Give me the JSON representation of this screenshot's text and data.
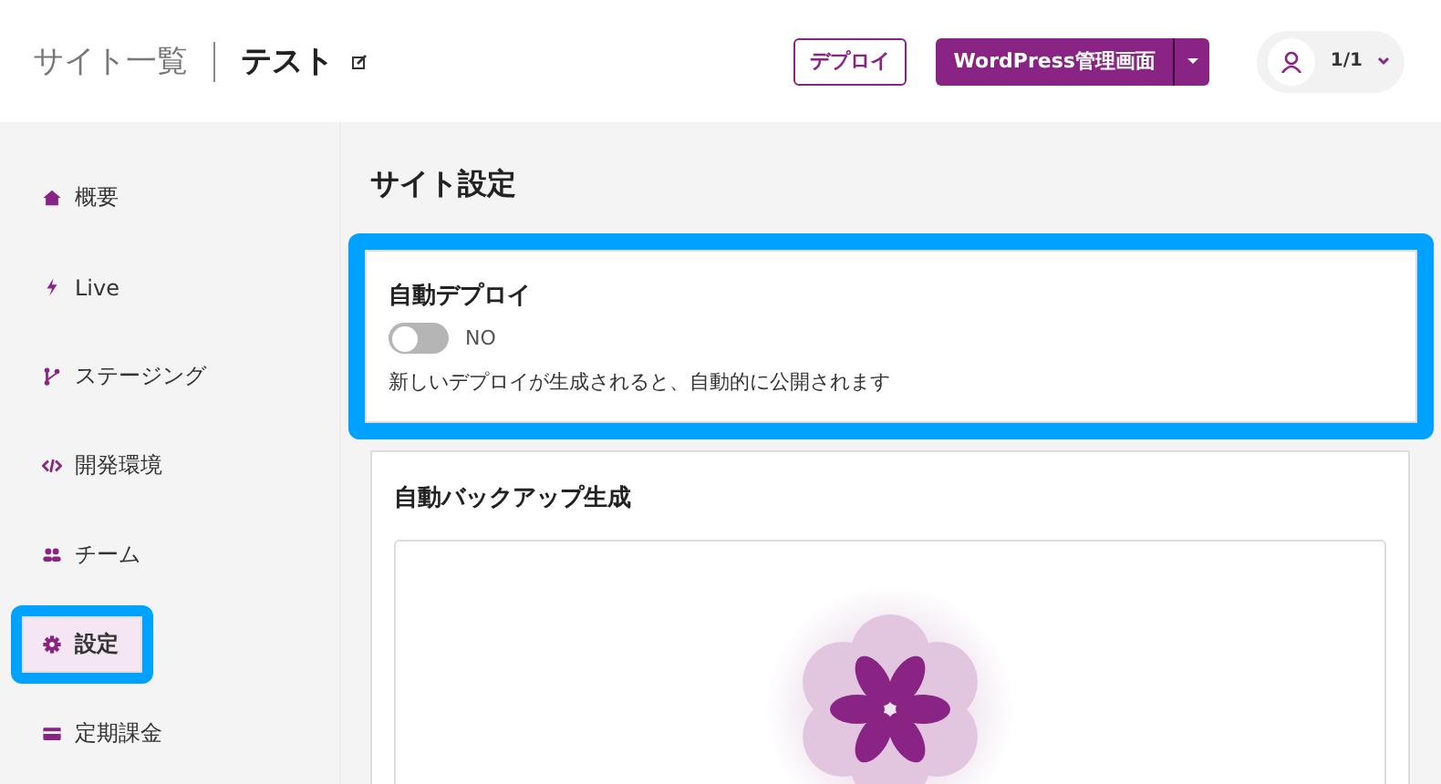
{
  "header": {
    "breadcrumb_parent": "サイト一覧",
    "site_name": "テスト",
    "deploy_button": "デプロイ",
    "admin_button": "WordPress管理画面",
    "account": "1/1"
  },
  "sidebar": {
    "items": [
      {
        "kind": "home",
        "label": "概要",
        "selected": false,
        "highlighted": false
      },
      {
        "kind": "bolt",
        "label": "Live",
        "selected": false,
        "highlighted": false
      },
      {
        "kind": "branch",
        "label": "ステージング",
        "selected": false,
        "highlighted": false
      },
      {
        "kind": "code",
        "label": "開発環境",
        "selected": false,
        "highlighted": false
      },
      {
        "kind": "team",
        "label": "チーム",
        "selected": false,
        "highlighted": false
      },
      {
        "kind": "gear",
        "label": "設定",
        "selected": true,
        "highlighted": true
      },
      {
        "kind": "card",
        "label": "定期課金",
        "selected": false,
        "highlighted": false
      }
    ]
  },
  "main": {
    "title": "サイト設定",
    "auto_deploy": {
      "title": "自動デプロイ",
      "on": false,
      "state_label": "NO",
      "description": "新しいデプロイが生成されると、自動的に公開されます",
      "highlighted": true
    },
    "auto_backup": {
      "title": "自動バックアップ生成"
    }
  }
}
